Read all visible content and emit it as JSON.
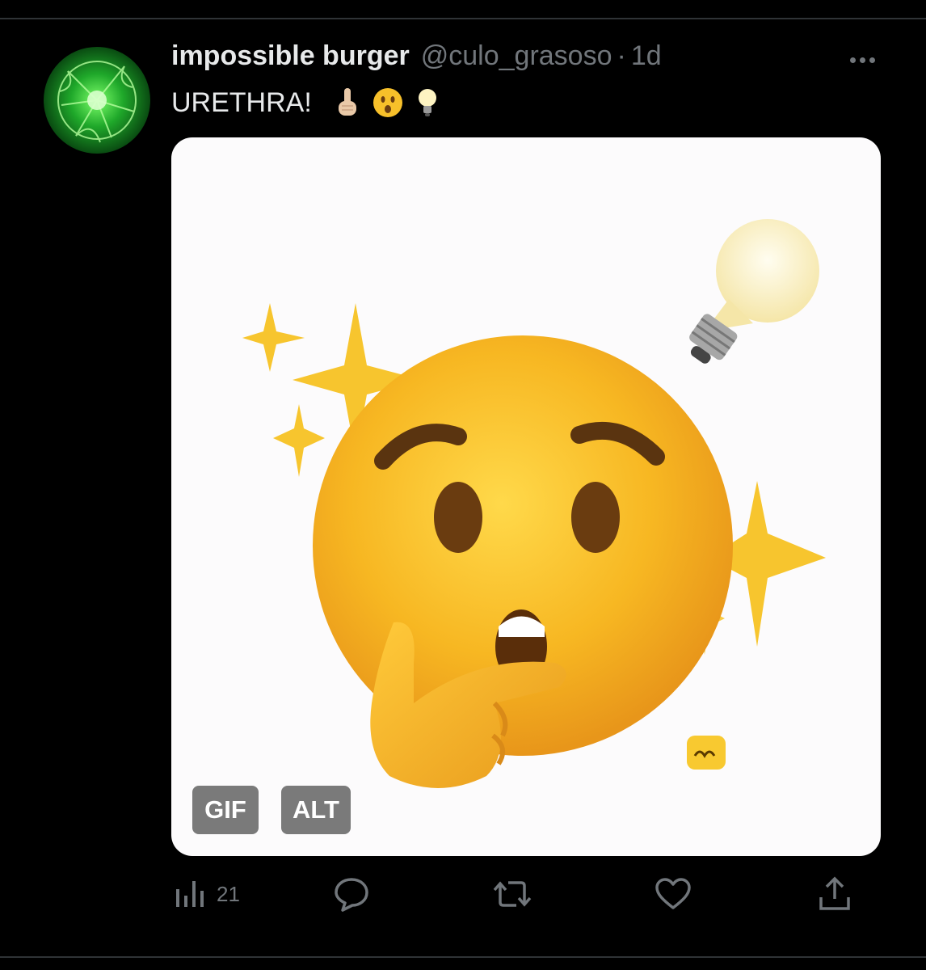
{
  "tweet": {
    "display_name": "impossible burger",
    "handle": "@culo_grasoso",
    "separator": "·",
    "time": "1d",
    "text": "URETHRA!",
    "emojis": [
      "index-pointing-up-icon",
      "hushed-face-icon",
      "light-bulb-icon"
    ]
  },
  "media": {
    "badges": {
      "gif": "GIF",
      "alt": "ALT"
    },
    "content": [
      "thinking-face-icon",
      "sparkles-icon",
      "light-bulb-icon"
    ]
  },
  "actions": {
    "views_count": "21",
    "icons": [
      "views-icon",
      "reply-icon",
      "retweet-icon",
      "like-icon",
      "share-icon"
    ]
  },
  "colors": {
    "background": "#000000",
    "text_primary": "#e7e9ea",
    "text_secondary": "#71767b",
    "badge_bg": "#7a7a7a",
    "media_bg": "#fcfbfc"
  }
}
